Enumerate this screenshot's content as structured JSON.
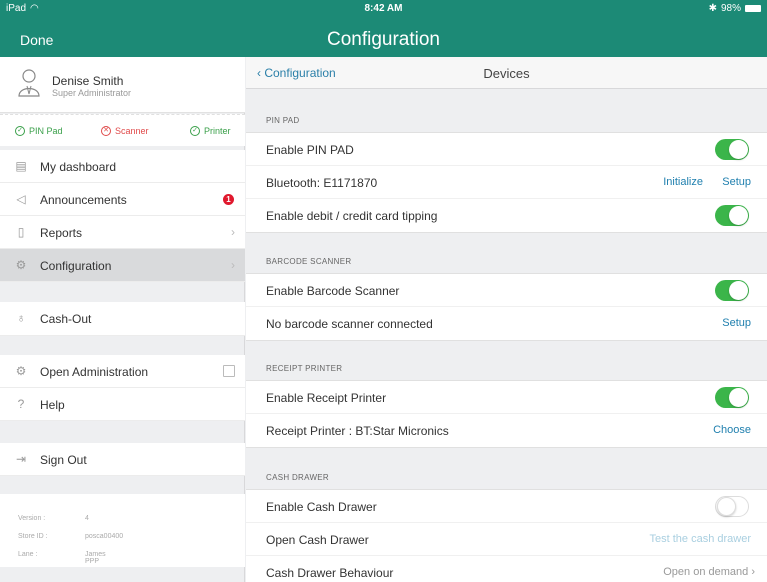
{
  "status": {
    "carrier": "iPad",
    "wifi": "wifi-icon",
    "time": "8:42 AM",
    "battery": "98%",
    "bluetooth": "bluetooth-icon"
  },
  "topbar": {
    "done_label": "Done",
    "title": "Configuration"
  },
  "profile": {
    "name": "Denise Smith",
    "role": "Super Administrator"
  },
  "devices": {
    "pin": "PIN Pad",
    "scanner": "Scanner",
    "printer": "Printer"
  },
  "menu": {
    "dashboard": "My dashboard",
    "announcements": "Announcements",
    "announcements_badge": "1",
    "reports": "Reports",
    "configuration": "Configuration",
    "cashout": "Cash-Out",
    "open_admin": "Open Administration",
    "help": "Help",
    "signout": "Sign Out"
  },
  "meta": {
    "version_label": "Version :",
    "version_value": "4",
    "store_label": "Store ID :",
    "store_value": "posca00400",
    "lane_label": "Lane :",
    "lane_value": "James PPP"
  },
  "pane": {
    "back_label": "Configuration",
    "title": "Devices",
    "pinpad": {
      "header": "PIN PAD",
      "enable": "Enable PIN PAD",
      "bluetooth": "Bluetooth: E1171870",
      "initialize": "Initialize",
      "setup": "Setup",
      "tipping": "Enable debit / credit card tipping"
    },
    "barcode": {
      "header": "BARCODE SCANNER",
      "enable": "Enable Barcode Scanner",
      "none": "No barcode scanner connected",
      "setup": "Setup"
    },
    "printer": {
      "header": "RECEIPT PRINTER",
      "enable": "Enable Receipt Printer",
      "device": "Receipt Printer : BT:Star Micronics",
      "choose": "Choose"
    },
    "drawer": {
      "header": "CASH DRAWER",
      "enable": "Enable Cash Drawer",
      "open": "Open Cash Drawer",
      "test": "Test the cash drawer",
      "behaviour": "Cash Drawer Behaviour",
      "behaviour_value": "Open on demand"
    }
  },
  "toggles": {
    "pinpad_enabled": true,
    "tipping_enabled": true,
    "barcode_enabled": true,
    "printer_enabled": true,
    "drawer_enabled": false
  },
  "colors": {
    "accent": "#1c8a76",
    "toggle_on": "#3bb54a",
    "link": "#1f7fae",
    "alert": "#e0182d"
  }
}
